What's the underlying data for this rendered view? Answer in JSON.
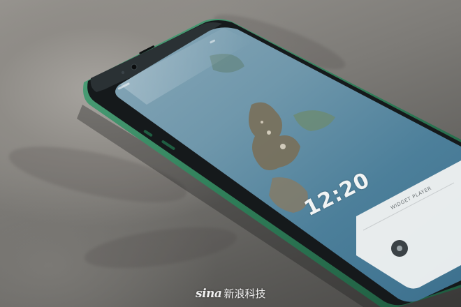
{
  "screen": {
    "clock_time": "12:20",
    "player_label": "WIDGET PLAYER"
  },
  "watermark": {
    "logo": "sina",
    "text": "新浪科技"
  },
  "colors": {
    "phone_frame_green": "#2f7d58",
    "screen_sky": "#5f8fa8",
    "background_stone": "#8f8c87"
  },
  "icons": {
    "player_disc": "disc-icon",
    "logo_eye": "eye-icon"
  }
}
